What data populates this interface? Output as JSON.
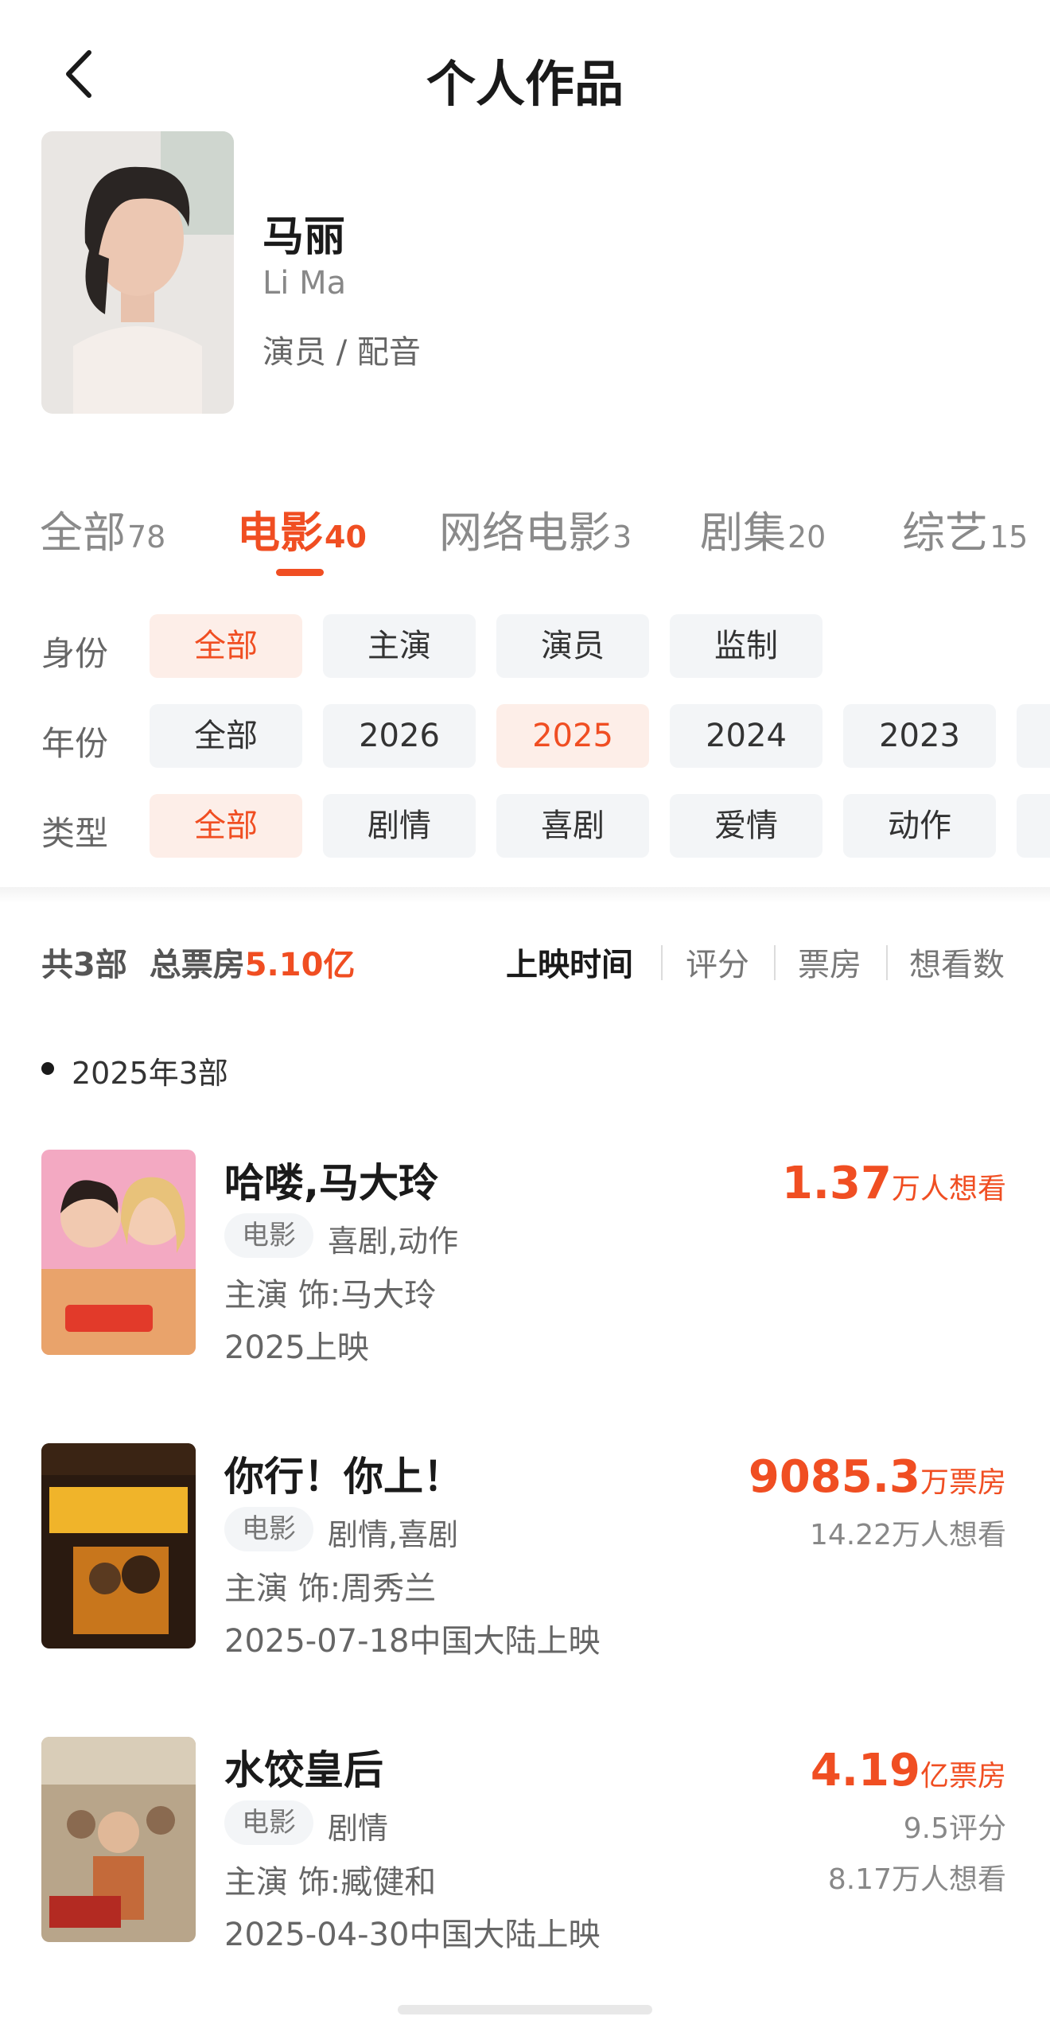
{
  "header": {
    "title": "个人作品",
    "back_icon": "chevron-left-icon"
  },
  "profile": {
    "name": "马丽",
    "english_name": "Li Ma",
    "roles": "演员 / 配音"
  },
  "tabs": [
    {
      "label": "全部",
      "count": "78",
      "active": false
    },
    {
      "label": "电影",
      "count": "40",
      "active": true
    },
    {
      "label": "网络电影",
      "count": "3",
      "active": false
    },
    {
      "label": "剧集",
      "count": "20",
      "active": false
    },
    {
      "label": "综艺",
      "count": "15",
      "active": false
    }
  ],
  "filters": {
    "identity": {
      "label": "身份",
      "options": [
        "全部",
        "主演",
        "演员",
        "监制"
      ],
      "selected": "全部"
    },
    "year": {
      "label": "年份",
      "options": [
        "全部",
        "2026",
        "2025",
        "2024",
        "2023"
      ],
      "selected": "2025"
    },
    "genre": {
      "label": "类型",
      "options": [
        "全部",
        "剧情",
        "喜剧",
        "爱情",
        "动作"
      ],
      "selected": "全部"
    }
  },
  "summary": {
    "count_text": "共3部",
    "box_label": "总票房",
    "box_value": "5.10亿",
    "sort_options": [
      "上映时间",
      "评分",
      "票房",
      "想看数"
    ],
    "sort_selected": "上映时间"
  },
  "year_group": "2025年3部",
  "movies": [
    {
      "title": "哈喽,马大玲",
      "tag": "电影",
      "genre": "喜剧,动作",
      "role": "主演 饰:马大玲",
      "release": "2025上映",
      "stat_num": "1.37",
      "stat_unit": "万人想看",
      "stat_extra": []
    },
    {
      "title": "你行！你上！",
      "tag": "电影",
      "genre": "剧情,喜剧",
      "role": "主演 饰:周秀兰",
      "release": "2025-07-18中国大陆上映",
      "stat_num": "9085.3",
      "stat_unit": "万票房",
      "stat_extra": [
        "14.22万人想看"
      ]
    },
    {
      "title": "水饺皇后",
      "tag": "电影",
      "genre": "剧情",
      "role": "主演 饰:臧健和",
      "release": "2025-04-30中国大陆上映",
      "stat_num": "4.19",
      "stat_unit": "亿票房",
      "stat_extra": [
        "9.5评分",
        "8.17万人想看"
      ]
    }
  ],
  "colors": {
    "accent": "#f04e22",
    "chip_bg": "#f3f5f7",
    "chip_selected_bg": "#fdeee8"
  }
}
